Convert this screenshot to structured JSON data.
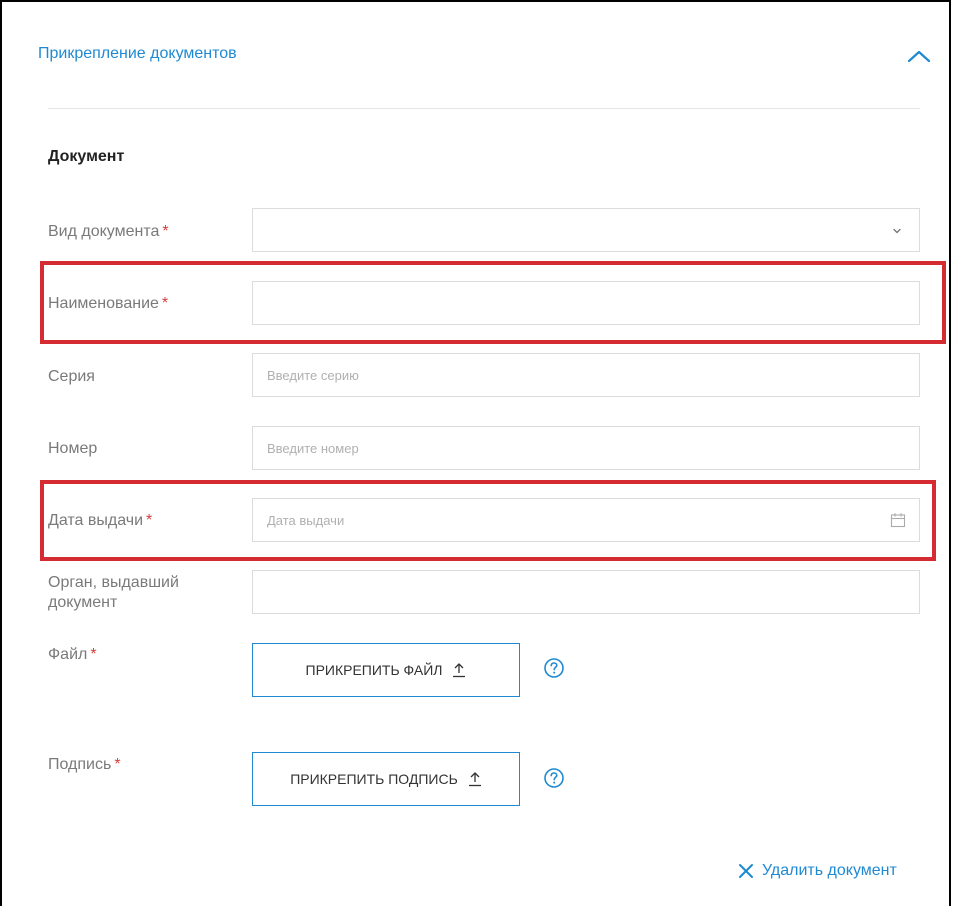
{
  "section": {
    "title": "Прикрепление документов"
  },
  "document": {
    "title": "Документ",
    "required_mark": "*",
    "fields": {
      "doc_type": {
        "label": "Вид документа",
        "value": ""
      },
      "name": {
        "label": "Наименование",
        "value": ""
      },
      "series": {
        "label": "Серия",
        "placeholder": "Введите серию"
      },
      "number": {
        "label": "Номер",
        "placeholder": "Введите номер"
      },
      "issue_date": {
        "label": "Дата выдачи",
        "placeholder": "Дата выдачи"
      },
      "issuer": {
        "label_line1": "Орган, выдавший",
        "label_line2": "документ",
        "value": ""
      },
      "file": {
        "label": "Файл",
        "button_label": "ПРИКРЕПИТЬ ФАЙЛ"
      },
      "signature": {
        "label": "Подпись",
        "button_label": "ПРИКРЕПИТЬ ПОДПИСЬ"
      }
    },
    "delete_label": "Удалить документ"
  },
  "icons": {
    "collapse": "chevron-up-icon",
    "select": "chevron-down-icon",
    "calendar": "calendar-icon",
    "upload": "upload-icon",
    "help": "help-icon",
    "delete": "close-icon"
  },
  "colors": {
    "accent": "#1f8ad2",
    "required": "#d63d3d",
    "highlight": "#d52b33",
    "border": "#dcdcdc"
  }
}
